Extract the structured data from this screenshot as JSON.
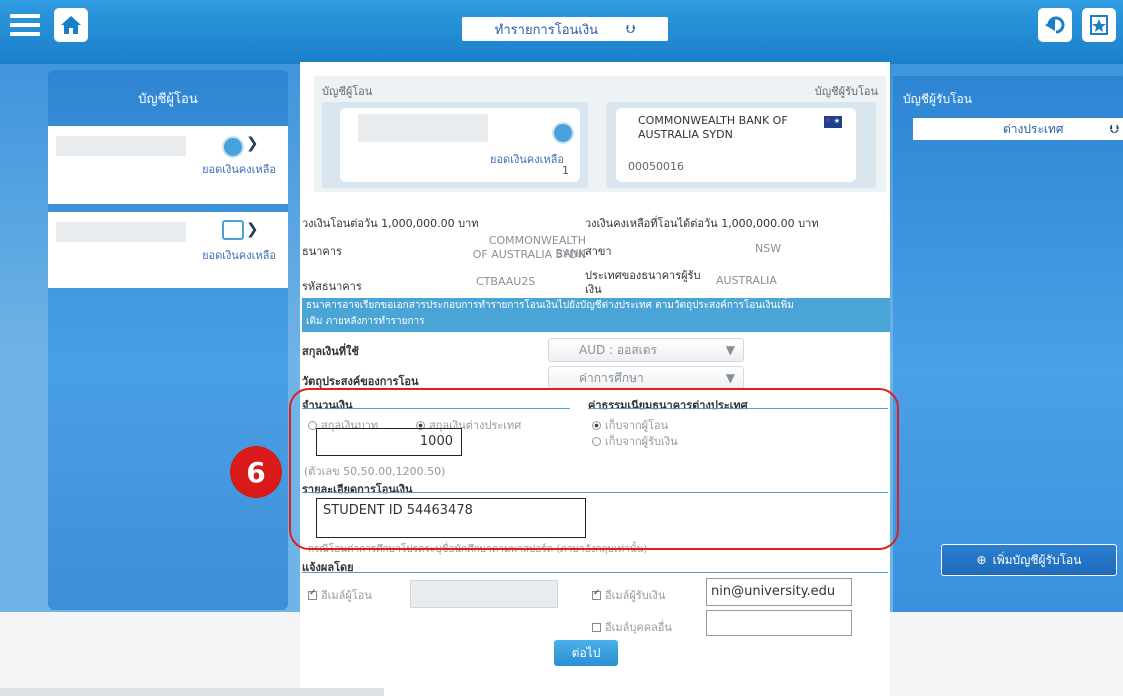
{
  "header": {
    "title": "ทำรายการโอนเงิน",
    "dropdown_glyph": "▼"
  },
  "left_panel": {
    "title": "บัญชีผู้โอน",
    "accounts": [
      {
        "balance_label": "ยอดเงินคงเหลือ"
      },
      {
        "balance_label": "ยอดเงินคงเหลือ"
      }
    ]
  },
  "cards": {
    "from_label": "บัญชีผู้โอน",
    "to_label": "บัญชีผู้รับโอน",
    "from_balance_label": "ยอดเงินคงเหลือ",
    "from_balance_value": "1",
    "to_bank_line1": "COMMONWEALTH BANK OF",
    "to_bank_line2": "AUSTRALIA SYDN",
    "to_account": "00050016"
  },
  "details": {
    "daily_limit": "วงเงินโอนต่อวัน 1,000,000.00 บาท",
    "remaining_limit": "วงเงินคงเหลือที่โอนได้ต่อวัน 1,000,000.00 บาท",
    "bank_label": "ธนาคาร",
    "bank_value_1": "COMMONWEALTH BANK",
    "bank_value_2": "OF AUSTRALIA SYDN",
    "branch_label": "สาขา",
    "branch_value": "NSW",
    "swift_label": "รหัสธนาคาร",
    "swift_value": "CTBAAU2S",
    "country_label_1": "ประเทศของธนาคารผู้รับ",
    "country_label_2": "เงิน",
    "country_value": "AUSTRALIA"
  },
  "notice": {
    "line1": "ธนาคารอาจเรียกขอเอกสารประกอบการทำรายการโอนเงินไปยังบัญชีต่างประเทศ ตามวัตถุประสงค์การโอนเงินเพิ่ม",
    "line2": "เติม ภายหลังการทำรายการ"
  },
  "currency": {
    "label": "สกุลเงินที่ใช้",
    "value": "AUD : ออสเตร"
  },
  "purpose": {
    "label": "วัตถุประสงค์ของการโอน",
    "value": "ค่าการศึกษา"
  },
  "amount_section": {
    "title": "จำนวนเงิน",
    "option_thb": "สกุลเงินบาท",
    "option_foreign": "สกุลเงินต่างประเทศ",
    "value": "1000",
    "hint": "(ตัวเลข 50,50.00,1200.50)"
  },
  "fee_section": {
    "title": "ค่าธรรมเนียมธนาคารต่างประเทศ",
    "option_sender": "เก็บจากผู้โอน",
    "option_receiver": "เก็บจากผู้รับเงิน"
  },
  "detail_section": {
    "title": "รายละเอียดการโอนเงิน",
    "value": "STUDENT ID 54463478",
    "note": "กรณีโอนค่าการศึกษาโปรดระบุชื่อนักศึกษาตามพาสปอร์ต (ภาษาอังกฤษเท่านั้น)"
  },
  "notify_section": {
    "title": "แจ้งผลโดย",
    "sender_email_label": "อีเมล์ผู้โอน",
    "receiver_email_label": "อีเมล์ผู้รับเงิน",
    "receiver_email_value": "nin@university.edu",
    "other_email_label": "อีเมล์บุคคลอื่น"
  },
  "next_button": "ต่อไป",
  "right_panel": {
    "title": "บัญชีผู้รับโอน",
    "filter_value": "ต่างประเทศ",
    "add_button": "เพิ่มบัญชีผู้รับโอน"
  },
  "annotation": {
    "step_number": "6"
  }
}
